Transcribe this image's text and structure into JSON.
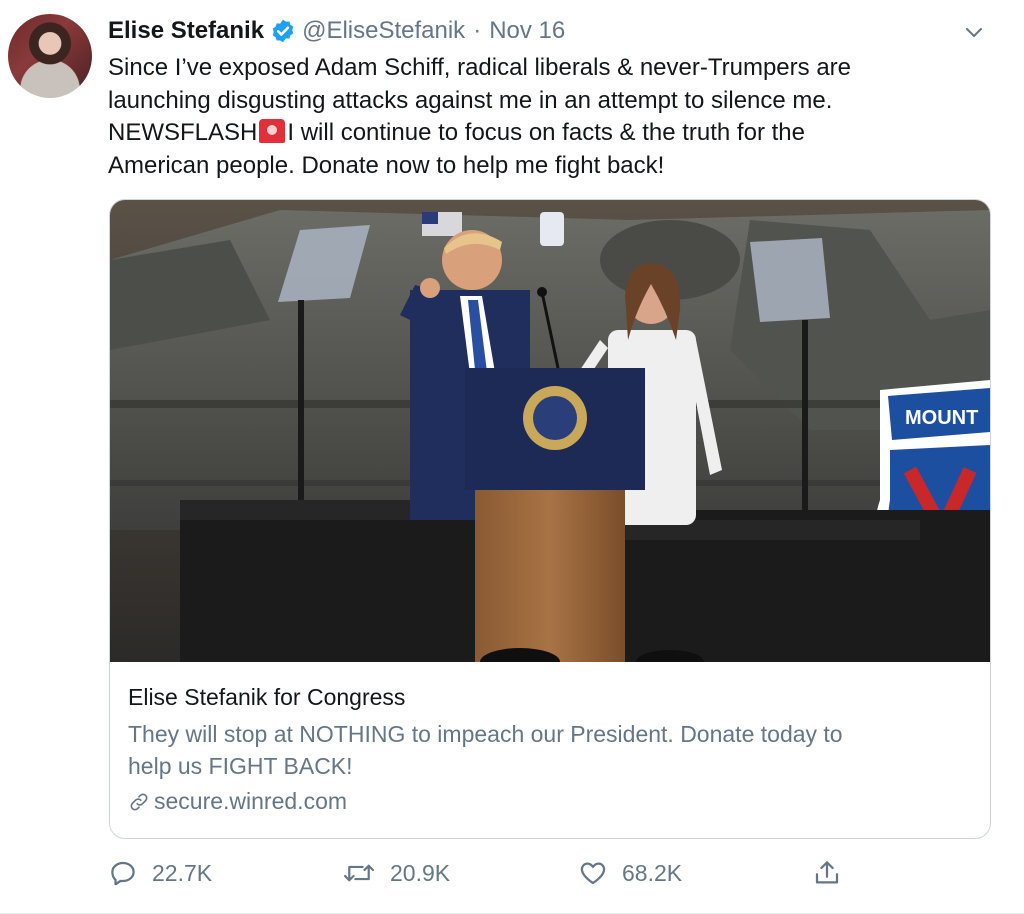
{
  "tweet": {
    "author_name": "Elise Stefanik",
    "handle": "@EliseStefanik",
    "separator": "·",
    "date": "Nov 16",
    "text_lines": [
      "Since I’ve exposed Adam Schiff, radical liberals & never-Trumpers are",
      "launching disgusting attacks against me in an attempt to silence me.",
      "NEWSFLASH",
      "I will continue to focus on facts & the truth for the",
      "American people. Donate now to help me fight back!"
    ],
    "emoji": "rotating-light-icon"
  },
  "card": {
    "title": "Elise Stefanik for Congress",
    "description_lines": [
      "They will stop at NOTHING to impeach our President. Donate today to",
      "help us FIGHT BACK!"
    ],
    "domain": "secure.winred.com",
    "photo_sign_text": "MOUNT"
  },
  "actions": {
    "replies": "22.7K",
    "retweets": "20.9K",
    "likes": "68.2K"
  },
  "colors": {
    "text": "#14171a",
    "secondary": "#657786",
    "verified": "#1da1f2",
    "border": "#ccd6dd"
  }
}
